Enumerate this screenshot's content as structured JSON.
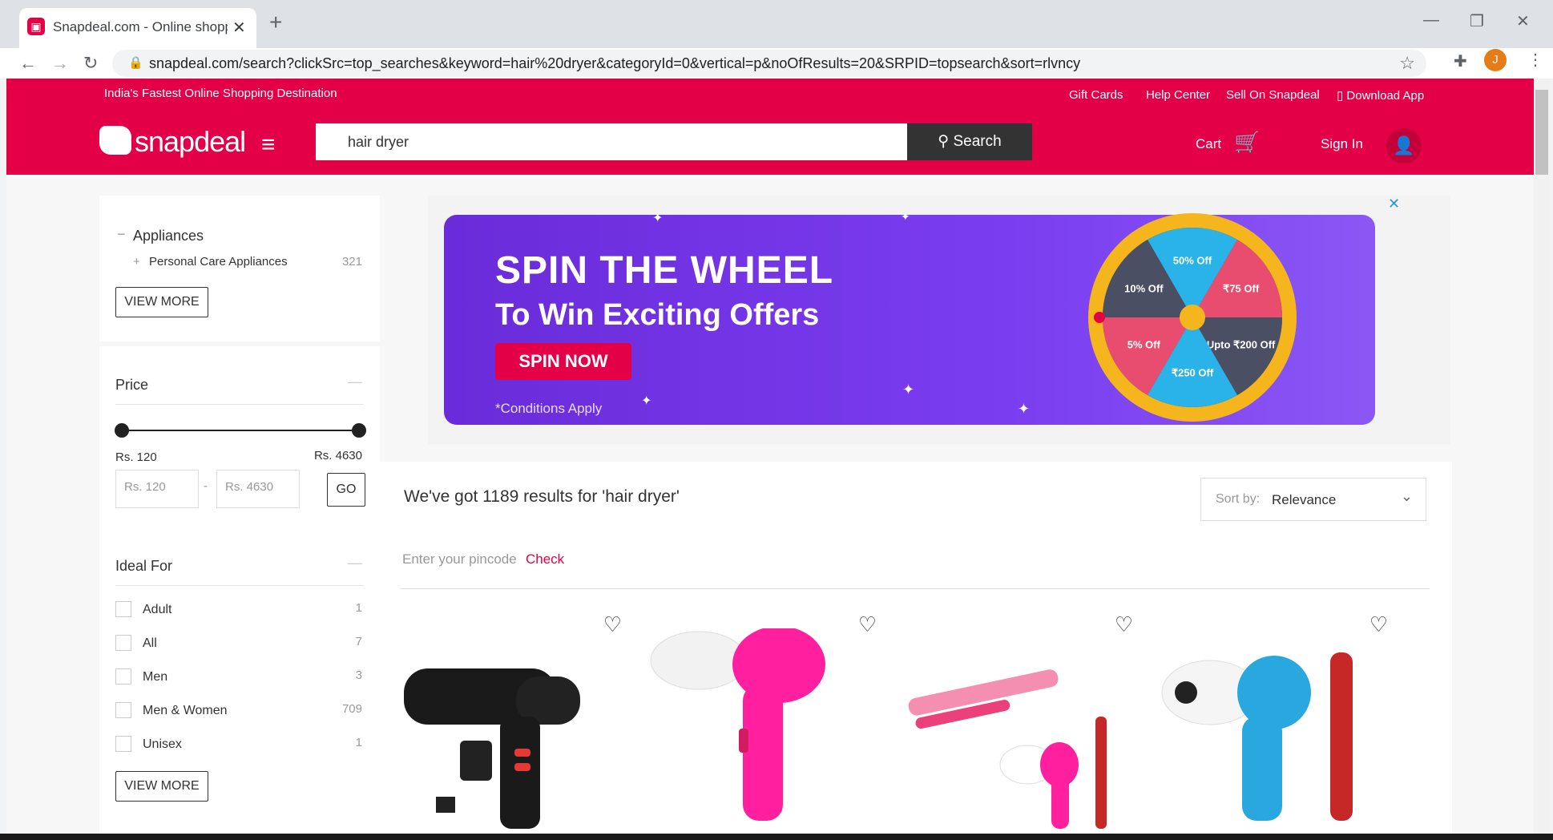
{
  "browser": {
    "tab_title": "Snapdeal.com - Online shopping",
    "new_tab": "+",
    "url": "snapdeal.com/search?clickSrc=top_searches&keyword=hair%20dryer&categoryId=0&vertical=p&noOfResults=20&SRPID=topsearch&sort=rlvncy",
    "profile_initial": "J"
  },
  "topbar": {
    "tagline": "India's Fastest Online Shopping Destination",
    "links": [
      "Gift Cards",
      "Help Center",
      "Sell On Snapdeal",
      "Download App"
    ]
  },
  "header": {
    "logo": "snapdeal",
    "search_value": "hair dryer",
    "search_button": "Search",
    "cart": "Cart",
    "signin": "Sign In"
  },
  "filters": {
    "category": {
      "title": "Appliances",
      "sub_label": "Personal Care Appliances",
      "sub_count": "321",
      "view_more": "VIEW MORE"
    },
    "price": {
      "title": "Price",
      "min_label": "Rs. 120",
      "max_label": "Rs. 4630",
      "min_input": "Rs. 120",
      "max_input": "Rs. 4630",
      "go": "GO",
      "range_min_fraction": 0,
      "range_max_fraction": 1
    },
    "ideal_for": {
      "title": "Ideal For",
      "items": [
        {
          "label": "Adult",
          "count": "1"
        },
        {
          "label": "All",
          "count": "7"
        },
        {
          "label": "Men",
          "count": "3"
        },
        {
          "label": "Men & Women",
          "count": "709"
        },
        {
          "label": "Unisex",
          "count": "1"
        }
      ],
      "view_more": "VIEW MORE"
    }
  },
  "banner": {
    "title": "SPIN THE WHEEL",
    "subtitle": "To Win Exciting Offers",
    "button": "SPIN NOW",
    "conditions": "*Conditions Apply",
    "close": "✕",
    "wheel_segments": [
      "50% Off",
      "₹75 Off",
      "Upto ₹200 Off",
      "₹250 Off",
      "5% Off",
      "10% Off"
    ]
  },
  "results": {
    "title": "We've got 1189 results for 'hair dryer'",
    "sort_label": "Sort by:",
    "sort_value": "Relevance",
    "pincode_placeholder": "Enter your pincode",
    "check": "Check"
  },
  "colors": {
    "brand": "#e40046",
    "dark_button": "#333333",
    "banner_purple": "#7a3df0",
    "wheel_blue": "#2ab3e8",
    "wheel_pink": "#e84d6f",
    "wheel_dark": "#4b4f63",
    "wheel_rim": "#f5b51c"
  }
}
